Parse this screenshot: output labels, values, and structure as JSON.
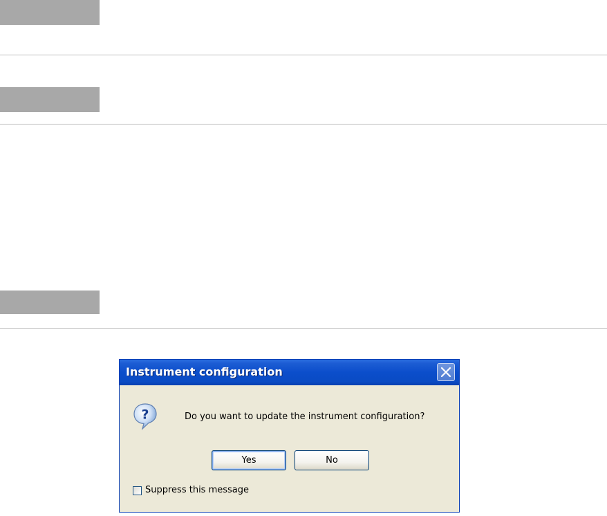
{
  "dialog": {
    "title": "Instrument configuration",
    "message": "Do you want to update the instrument configuration?",
    "yes_label": "Yes",
    "no_label": "No",
    "suppress_label": "Suppress this message",
    "suppress_checked": false,
    "icons": {
      "close": "close-icon",
      "question": "question-icon"
    }
  },
  "colors": {
    "section_block": "#a8a8a8",
    "rule": "#bdbdbd",
    "titlebar": "#0b4ecb",
    "dialog_bg": "#ece9d8"
  }
}
